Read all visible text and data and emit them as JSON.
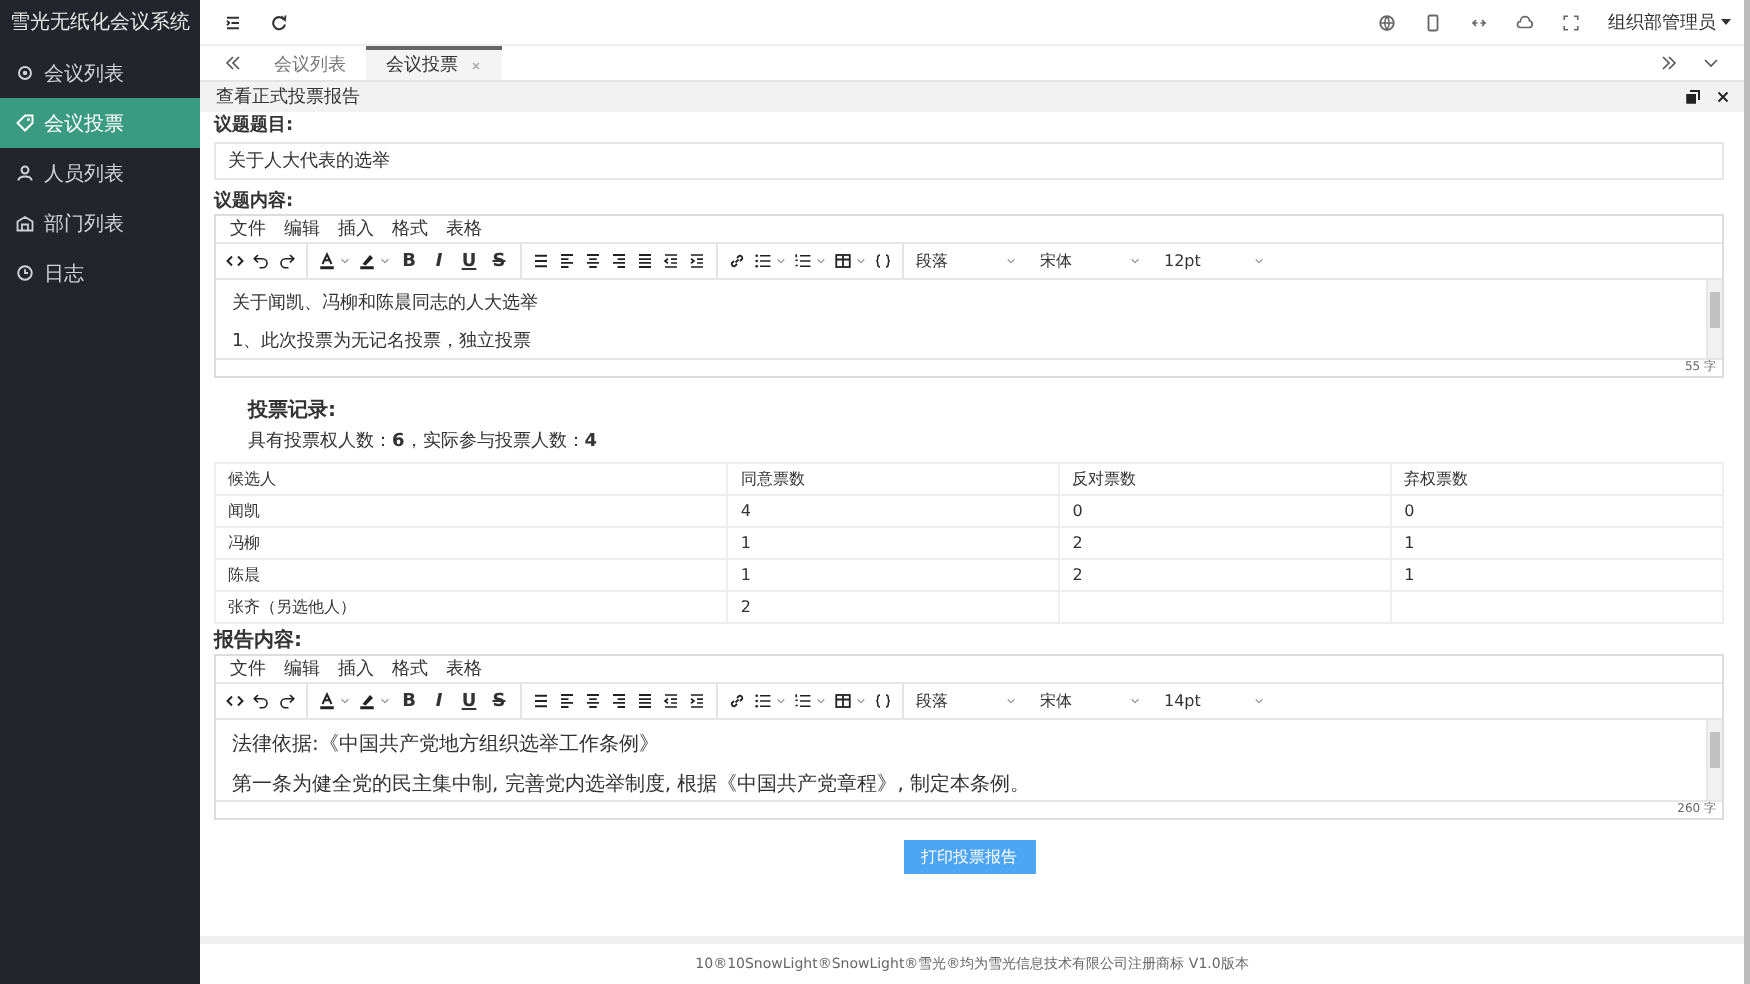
{
  "sidebar": {
    "title": "雪光无纸化会议系统",
    "items": [
      {
        "label": "会议列表",
        "selected": false
      },
      {
        "label": "会议投票",
        "selected": true
      },
      {
        "label": "人员列表",
        "selected": false
      },
      {
        "label": "部门列表",
        "selected": false
      },
      {
        "label": "日志",
        "selected": false
      }
    ]
  },
  "header": {
    "user": "组织部管理员"
  },
  "tabs": [
    {
      "label": "会议列表",
      "selected": false
    },
    {
      "label": "会议投票",
      "selected": true
    }
  ],
  "panel": {
    "title": "查看正式投票报告",
    "topic_label": "议题题目:",
    "topic_value": "关于人大代表的选举",
    "content_label": "议题内容:",
    "editor_1": {
      "menu": [
        "文件",
        "编辑",
        "插入",
        "格式",
        "表格"
      ],
      "format_buttons": [
        "B",
        "I",
        "U",
        "S"
      ],
      "selects": [
        "段落",
        "宋体",
        "12pt"
      ],
      "lines": [
        "关于闻凯、冯柳和陈晨同志的人大选举",
        "1、此次投票为无记名投票，独立投票"
      ],
      "word_count": "55 字"
    },
    "vote_title": "投票记录:",
    "vote_summary": "具有投票权人数：**6**，实际参与投票人数：**4**",
    "table": {
      "columns": [
        "候选人",
        "同意票数",
        "反对票数",
        "弃权票数"
      ],
      "rows": [
        [
          "闻凯",
          "4",
          "0",
          "0"
        ],
        [
          "冯柳",
          "1",
          "2",
          "1"
        ],
        [
          "陈晨",
          "1",
          "2",
          "1"
        ],
        [
          "张齐（另选他人）",
          "2",
          "",
          ""
        ]
      ]
    },
    "report_label": "报告内容:",
    "editor_2": {
      "menu": [
        "文件",
        "编辑",
        "插入",
        "格式",
        "表格"
      ],
      "format_buttons": [
        "B",
        "I",
        "U",
        "S"
      ],
      "selects": [
        "段落",
        "宋体",
        "14pt"
      ],
      "lines": [
        "法律依据:《中国共产党地方组织选举工作条例》",
        "第一条为健全党的民主集中制, 完善党内选举制度, 根据《中国共产党章程》, 制定本条例。"
      ],
      "word_count": "260 字"
    },
    "print_button": "打印投票报告"
  },
  "footer": "10®10SnowLight®SnowLight®雪光®均为雪光信息技术有限公司注册商标 V1.0版本"
}
